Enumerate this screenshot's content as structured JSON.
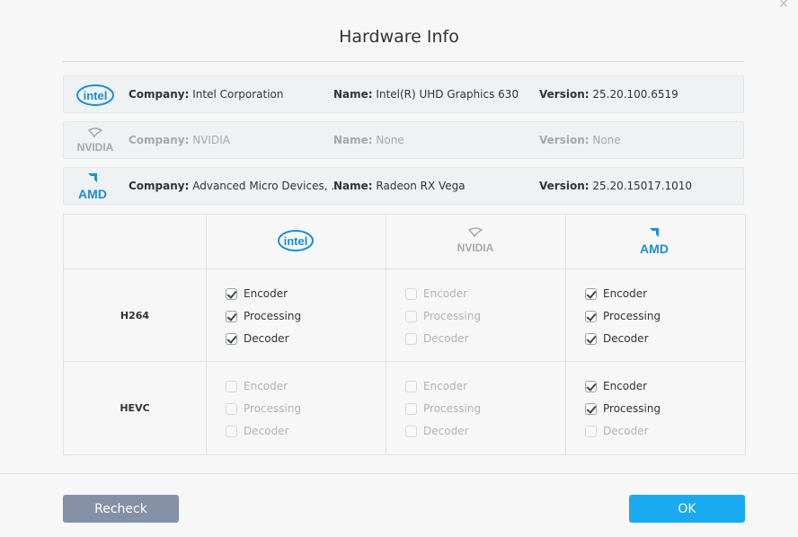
{
  "window": {
    "title": "Hardware Info",
    "close_glyph": "×"
  },
  "gpus": [
    {
      "vendor": "Intel",
      "logo_text": "intel",
      "company_label": "Company:",
      "company": "Intel Corporation",
      "name_label": "Name:",
      "name": "Intel(R) UHD Graphics 630",
      "version_label": "Version:",
      "version": "25.20.100.6519",
      "detected": true
    },
    {
      "vendor": "NVIDIA",
      "logo_text": "NVIDIA",
      "company_label": "Company:",
      "company": "NVIDIA",
      "name_label": "Name:",
      "name": "None",
      "version_label": "Version:",
      "version": "None",
      "detected": false
    },
    {
      "vendor": "AMD",
      "logo_text": "AMD",
      "company_label": "Company:",
      "company": "Advanced Micro Devices, ...",
      "name_label": "Name:",
      "name": "Radeon RX Vega",
      "version_label": "Version:",
      "version": "25.20.15017.1010",
      "detected": true
    }
  ],
  "matrix": {
    "columns": [
      "intel-logo",
      "nvidia-logo",
      "amd-logo"
    ],
    "codecs": [
      {
        "label": "H264",
        "cells": [
          {
            "options": [
              {
                "label": "Encoder",
                "checked": true,
                "enabled": true
              },
              {
                "label": "Processing",
                "checked": true,
                "enabled": true
              },
              {
                "label": "Decoder",
                "checked": true,
                "enabled": true
              }
            ]
          },
          {
            "options": [
              {
                "label": "Encoder",
                "checked": false,
                "enabled": false
              },
              {
                "label": "Processing",
                "checked": false,
                "enabled": false
              },
              {
                "label": "Decoder",
                "checked": false,
                "enabled": false
              }
            ]
          },
          {
            "options": [
              {
                "label": "Encoder",
                "checked": true,
                "enabled": true
              },
              {
                "label": "Processing",
                "checked": true,
                "enabled": true
              },
              {
                "label": "Decoder",
                "checked": true,
                "enabled": true
              }
            ]
          }
        ]
      },
      {
        "label": "HEVC",
        "cells": [
          {
            "options": [
              {
                "label": "Encoder",
                "checked": false,
                "enabled": false
              },
              {
                "label": "Processing",
                "checked": false,
                "enabled": false
              },
              {
                "label": "Decoder",
                "checked": false,
                "enabled": false
              }
            ]
          },
          {
            "options": [
              {
                "label": "Encoder",
                "checked": false,
                "enabled": false
              },
              {
                "label": "Processing",
                "checked": false,
                "enabled": false
              },
              {
                "label": "Decoder",
                "checked": false,
                "enabled": false
              }
            ]
          },
          {
            "options": [
              {
                "label": "Encoder",
                "checked": true,
                "enabled": true
              },
              {
                "label": "Processing",
                "checked": true,
                "enabled": true
              },
              {
                "label": "Decoder",
                "checked": false,
                "enabled": false
              }
            ]
          }
        ]
      }
    ]
  },
  "buttons": {
    "recheck": "Recheck",
    "ok": "OK"
  },
  "colors": {
    "intel_blue": "#1a8fd6",
    "amd_blue": "#1a8fd6",
    "nvidia_gray": "#9a9a9a",
    "ok_button": "#19aaf1",
    "recheck_button": "#8390a6"
  }
}
